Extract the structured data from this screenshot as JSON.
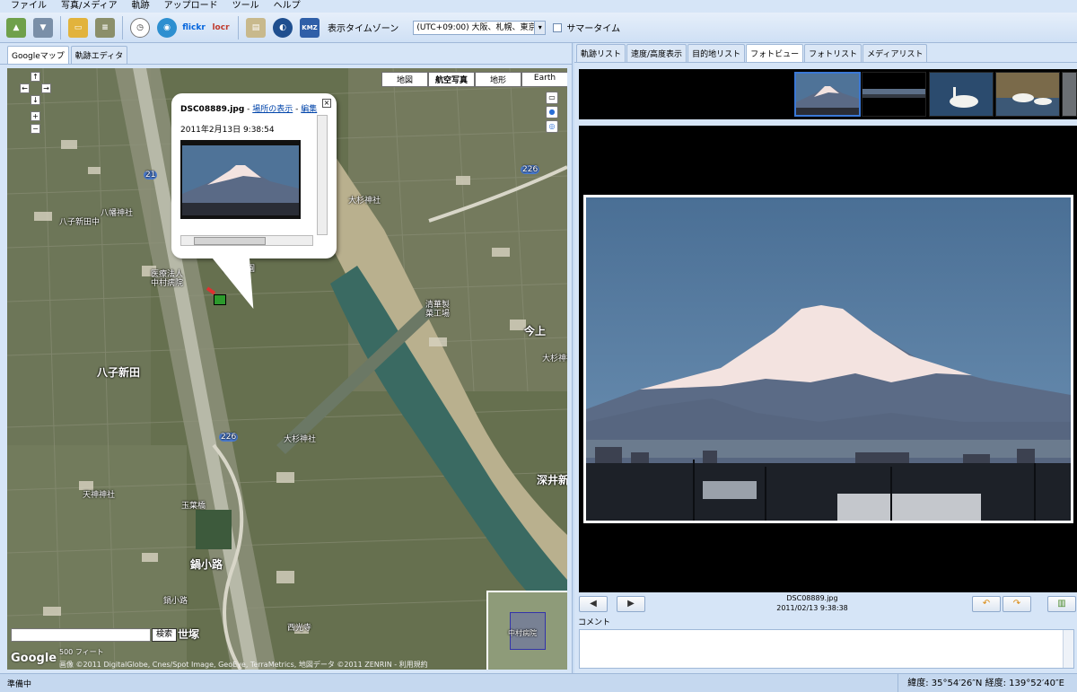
{
  "menu": {
    "items": [
      "ファイル",
      "写真/メディア",
      "軌跡",
      "アップロード",
      "ツール",
      "ヘルプ"
    ]
  },
  "toolbar": {
    "buttons": [
      {
        "name": "import-icon",
        "label": ""
      },
      {
        "name": "export-icon",
        "label": ""
      },
      {
        "name": "open-folder-icon",
        "label": ""
      },
      {
        "name": "device-icon",
        "label": ""
      },
      {
        "name": "clock-icon",
        "label": ""
      },
      {
        "name": "globe-icon",
        "label": ""
      },
      {
        "name": "flickr-icon",
        "label": "flickr"
      },
      {
        "name": "locr-icon",
        "label": "locr"
      },
      {
        "name": "report-icon",
        "label": ""
      },
      {
        "name": "google-earth-icon",
        "label": ""
      },
      {
        "name": "kmz-icon",
        "label": "KMZ"
      }
    ],
    "timezone_label": "表示タイムゾーン",
    "timezone_value": "(UTC+09:00) 大阪、札幌、東京",
    "dst_label": "サマータイム"
  },
  "left_tabs": [
    "Googleマップ",
    "軌跡エディタ"
  ],
  "map": {
    "type_buttons": [
      "地図",
      "航空写真",
      "地形",
      "Earth"
    ],
    "type_selected": "航空写真",
    "labels": [
      {
        "text": "八幡神社",
        "big": false
      },
      {
        "text": "八子新田中",
        "big": false
      },
      {
        "text": "医療法人",
        "big": false
      },
      {
        "text": "中村病院",
        "big": false
      },
      {
        "text": "古川公園",
        "big": false
      },
      {
        "text": "八子新田",
        "big": true
      },
      {
        "text": "大杉神社",
        "big": false
      },
      {
        "text": "清華製",
        "big": false
      },
      {
        "text": "菓工場",
        "big": false
      },
      {
        "text": "今上",
        "big": true
      },
      {
        "text": "大杉神社",
        "big": false
      },
      {
        "text": "大杉神社",
        "big": false
      },
      {
        "text": "深井新",
        "big": true
      },
      {
        "text": "天神神社",
        "big": false
      },
      {
        "text": "玉葉橋",
        "big": false
      },
      {
        "text": "鍋小路",
        "big": true
      },
      {
        "text": "鍋小路",
        "big": false
      },
      {
        "text": "西光寺",
        "big": false
      },
      {
        "text": "世塚",
        "big": true
      }
    ],
    "route_markers": [
      "21",
      "226",
      "226"
    ],
    "search_button": "検索",
    "scale": "500 フィート",
    "google_logo": "Google",
    "copyright": "画像 ©2011 DigitalGlobe, Cnes/Spot Image, GeoEye, TerraMetrics, 地図データ ©2011 ZENRIN - 利用規約",
    "overview_label": "中村病院"
  },
  "infowindow": {
    "filename": "DSC08889.jpg",
    "sep": " - ",
    "link_location": "場所の表示",
    "sep2": " - ",
    "link_edit": "編集",
    "date": "2011年2月13日  9:38:54"
  },
  "right_tabs": [
    "軌跡リスト",
    "速度/高度表示",
    "目的地リスト",
    "フォトビュー",
    "フォトリスト",
    "メディアリスト"
  ],
  "right_tab_selected": "フォトビュー",
  "photo": {
    "name": "DSC08889.jpg",
    "datetime": "2011/02/13 9:38:38",
    "comment_label": "コメント",
    "comment_value": ""
  },
  "status": {
    "text": "準備中",
    "coords": "緯度: 35°54′26″N  経度: 139°52′40″E"
  },
  "colors": {
    "sky": "#4f7398",
    "snow": "#f3e3e0",
    "selection": "#3a78d6"
  }
}
